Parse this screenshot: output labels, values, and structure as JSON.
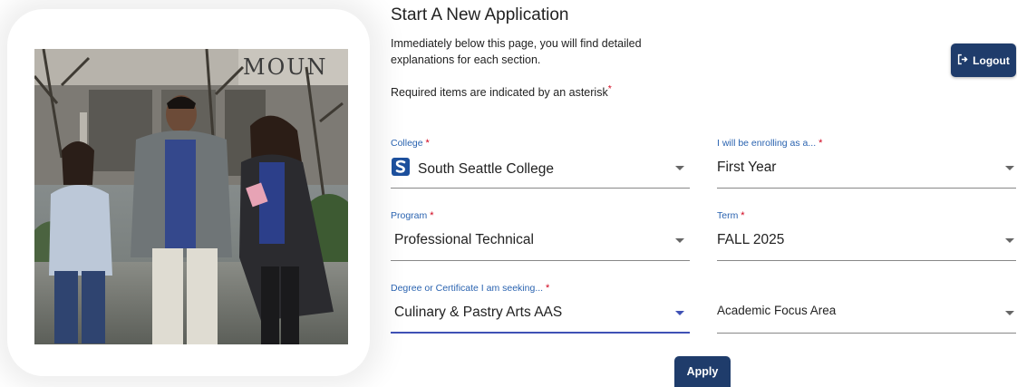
{
  "header": {
    "title": "Start A New Application",
    "intro": "Immediately below this page, you will find detailed explanations for each section.",
    "required_note": "Required items are indicated by an asterisk",
    "asterisk": "*"
  },
  "logout": {
    "label": "Logout",
    "icon": "logout-icon"
  },
  "photo": {
    "sign_text": "MOUN"
  },
  "form": {
    "college": {
      "label": "College",
      "value": "South Seattle College",
      "logo": "college-logo-icon"
    },
    "enrolling": {
      "label": "I will be enrolling as a...",
      "value": "First Year"
    },
    "program": {
      "label": "Program",
      "value": "Professional Technical"
    },
    "term": {
      "label": "Term",
      "value": "FALL 2025"
    },
    "degree": {
      "label": "Degree or Certificate I am seeking...",
      "value": "Culinary & Pastry Arts AAS"
    },
    "focus": {
      "placeholder": "Academic Focus Area"
    }
  },
  "apply": {
    "label": "Apply"
  },
  "colors": {
    "primary": "#1f3c6b",
    "label_blue": "#2a63b0",
    "asterisk_red": "#d0021b",
    "active_underline": "#3f51b5"
  }
}
